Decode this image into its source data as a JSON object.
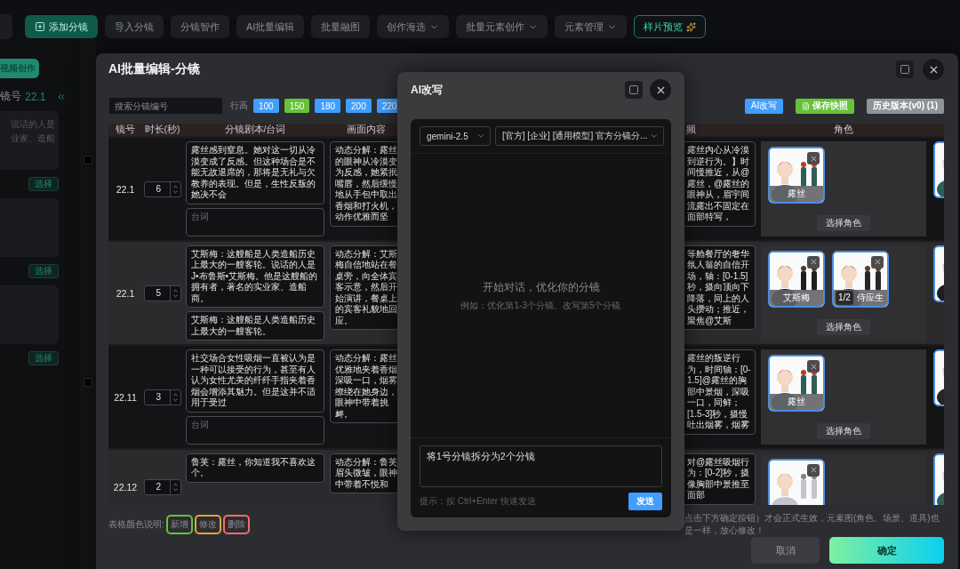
{
  "app_toolbar": {
    "buttons": [
      {
        "label": "添加分镜",
        "kind": "primary"
      },
      {
        "label": "导入分镜",
        "kind": "plain"
      },
      {
        "label": "分镜智作",
        "kind": "plain"
      },
      {
        "label": "AI批量编辑",
        "kind": "plain"
      },
      {
        "label": "批量融图",
        "kind": "plain"
      },
      {
        "label": "创作海选",
        "kind": "menu"
      },
      {
        "label": "批量元素创作",
        "kind": "menu"
      },
      {
        "label": "元素管理",
        "kind": "menu"
      },
      {
        "label": "样片预览",
        "kind": "accent"
      }
    ]
  },
  "side_panel": {
    "video_button": "视频创作",
    "shot_label": "镜号",
    "shot_number": "22.1",
    "snippet_lines": [
      "说话的人是",
      "业家、造船"
    ],
    "select_buttons": [
      "选择",
      "选择",
      "选择"
    ],
    "checkboxes": [
      {
        "checked": false
      },
      {
        "checked": false
      }
    ]
  },
  "batch_editor": {
    "title": "AI批量编辑-分镜",
    "search": {
      "placeholder": "搜索分镜编号"
    },
    "row_height_label": "行高",
    "row_heights": [
      {
        "label": "100",
        "selected": false
      },
      {
        "label": "150",
        "selected": true
      },
      {
        "label": "180",
        "selected": false
      },
      {
        "label": "200",
        "selected": false
      },
      {
        "label": "220",
        "selected": false
      }
    ],
    "actions": [
      {
        "label": "AI改写",
        "kind": "ai"
      },
      {
        "label": "保存快照",
        "kind": "save"
      },
      {
        "label": "历史版本(v0) (1)",
        "kind": "history"
      }
    ],
    "table": {
      "columns": [
        "镜号",
        "时长(秒)",
        "分镜剧本/台词",
        "画面内容",
        "频",
        "角色"
      ],
      "rows": [
        {
          "shot": "22.1",
          "duration": "6",
          "script": "露丝感到窒息。她对这一切从冷漠变成了反感。但这种场合是不能无故退席的，那将是无礼与欠教养的表现。但是，生性反叛的她决不会",
          "dialogue": {
            "placeholder": "台词"
          },
          "visual": "动态分解：露丝的眼神从冷漠变为反感，她紧抿嘴唇，然后缓慢地从手包中取出香烟和打火机，动作优雅而坚",
          "video": "露丝内心从冷漠到逆行为。】时间慢推近，从@露丝，@露丝的眼神从，眉宇间流露出不固定在面部特写，",
          "characters": [
            {
              "name": "露丝"
            }
          ],
          "select_label": "选择角色"
        },
        {
          "shot": "22.1",
          "duration": "5",
          "script": "艾斯梅：这艘船是人类造船历史上最大的一艘客轮。说话的人是J•布鲁斯•艾斯梅。他是这艘船的拥有者，著名的实业家、造船商。",
          "dialogue": {
            "value": "艾斯梅：这艘船是人类造船历史上最大的一艘客轮。"
          },
          "visual": "动态分解：艾斯梅自信地站在餐桌旁，向全体宾客示意，然后开始演讲，餐桌上的宾客礼貌地回应。",
          "video": "等舱餐厅的奢华氛人翁的自信开场，轴：[0-1.5]秒，摄向顶向下降落，同上的人头攒动；推近，聚焦@艾斯",
          "characters": [
            {
              "name": "艾斯梅"
            },
            {
              "name": "侍应生",
              "badge": "1/2"
            }
          ],
          "select_label": "选择角色"
        },
        {
          "shot": "22.11",
          "duration": "3",
          "script": "社交场合女性吸烟一直被认为是一种可以接受的行为，甚至有人认为女性尤美的纤纤手指夹着香烟会增添其魅力。但是这并不适用于受过",
          "dialogue": {
            "placeholder": "台词"
          },
          "visual": "动态分解：露丝优雅地夹着香烟深吸一口，烟雾缭绕在她身边，眼神中带着挑衅。",
          "video": "露丝的叛逆行为，时间轴：[0-1.5]@露丝的胸部中景烟，深吸一口，同鲜；[1.5-3]秒，摄慢吐出烟雾，烟雾",
          "characters": [
            {
              "name": "露丝"
            }
          ],
          "select_label": "选择角色"
        },
        {
          "shot": "22.12",
          "duration": "2",
          "script": "鲁芙：露丝，你知道我不喜欢这个。",
          "visual": "动态分解：鲁芙眉头微皱，眼神中带着不悦和",
          "video": "对@露丝吸烟行为：[0-2]秒，摄像胸部中景推至面部"
        }
      ]
    },
    "legend": {
      "label": "表格颜色说明:",
      "items": [
        {
          "label": "新增",
          "color": "#67c23a"
        },
        {
          "label": "修改",
          "color": "#e6a23c"
        },
        {
          "label": "删除",
          "color": "#f56c6c"
        }
      ]
    },
    "notice": "点击下方确定按钮）才会正式生效，元素图(角色、场景、道具)也是一样，放心修改！",
    "buttons": [
      {
        "label": "取消",
        "kind": "cancel"
      },
      {
        "label": "确定",
        "kind": "confirm"
      }
    ]
  },
  "ai_rewrite": {
    "title": "AI改写",
    "model": "gemini-2.5",
    "preset": "[官方] [企业] [通用模型] 官方分镜分...",
    "empty_title": "开始对话，优化你的分镜",
    "empty_example": "例如：优化第1-3个分镜、改写第5个分镜",
    "input_value": "将1号分镜拆分为2个分镜",
    "hint": "提示：按 Ctrl+Enter 快速发送",
    "send_label": "发送"
  }
}
